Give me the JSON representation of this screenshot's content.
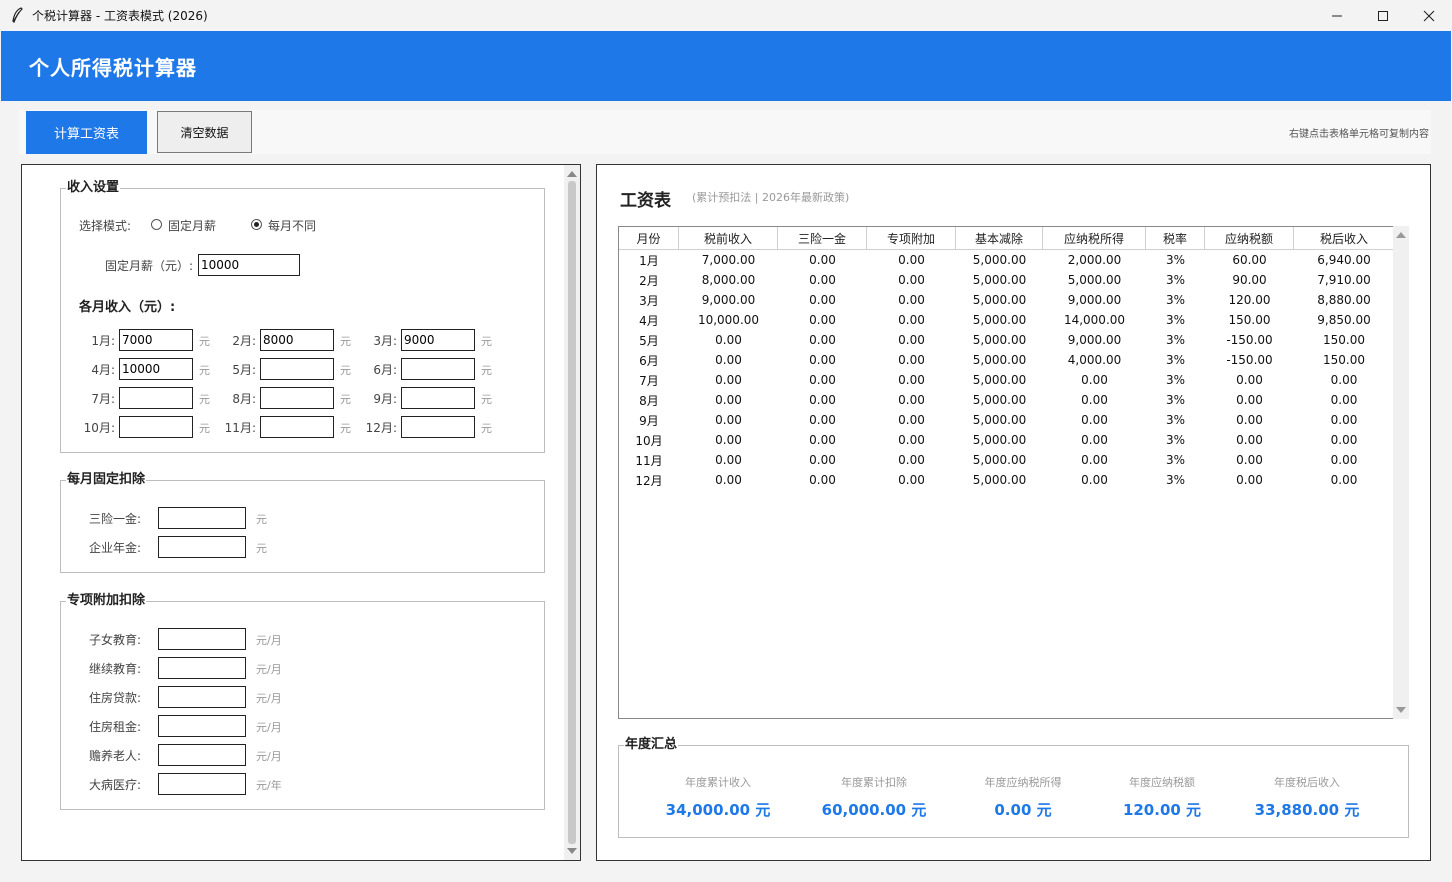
{
  "window": {
    "title": "个税计算器 - 工资表模式 (2026)",
    "icons": [
      "feather-icon",
      "minimize-icon",
      "maximize-icon",
      "close-icon"
    ]
  },
  "header": {
    "title": "个人所得税计算器"
  },
  "toolbar": {
    "calc_label": "计算工资表",
    "clear_label": "清空数据",
    "hint": "右键点击表格单元格可复制内容"
  },
  "income": {
    "legend": "收入设置",
    "mode_label": "选择模式:",
    "mode_fixed": "固定月薪",
    "mode_varied": "每月不同",
    "selected_mode": "每月不同",
    "fixed_label": "固定月薪（元）:",
    "fixed_value": "10000",
    "monthly_title": "各月收入（元）:",
    "unit": "元",
    "months": [
      {
        "label": "1月:",
        "value": "7000"
      },
      {
        "label": "2月:",
        "value": "8000"
      },
      {
        "label": "3月:",
        "value": "9000"
      },
      {
        "label": "4月:",
        "value": "10000"
      },
      {
        "label": "5月:",
        "value": ""
      },
      {
        "label": "6月:",
        "value": ""
      },
      {
        "label": "7月:",
        "value": ""
      },
      {
        "label": "8月:",
        "value": ""
      },
      {
        "label": "9月:",
        "value": ""
      },
      {
        "label": "10月:",
        "value": ""
      },
      {
        "label": "11月:",
        "value": ""
      },
      {
        "label": "12月:",
        "value": ""
      }
    ]
  },
  "fixed_deductions": {
    "legend": "每月固定扣除",
    "items": [
      {
        "label": "三险一金:",
        "value": "",
        "unit": "元"
      },
      {
        "label": "企业年金:",
        "value": "",
        "unit": "元"
      }
    ]
  },
  "special_deductions": {
    "legend": "专项附加扣除",
    "items": [
      {
        "label": "子女教育:",
        "value": "",
        "unit": "元/月"
      },
      {
        "label": "继续教育:",
        "value": "",
        "unit": "元/月"
      },
      {
        "label": "住房贷款:",
        "value": "",
        "unit": "元/月"
      },
      {
        "label": "住房租金:",
        "value": "",
        "unit": "元/月"
      },
      {
        "label": "赡养老人:",
        "value": "",
        "unit": "元/月"
      },
      {
        "label": "大病医疗:",
        "value": "",
        "unit": "元/年"
      }
    ]
  },
  "salary_table": {
    "title": "工资表",
    "subtitle": "(累计预扣法 | 2026年最新政策)",
    "columns": [
      "月份",
      "税前收入",
      "三险一金",
      "专项附加",
      "基本减除",
      "应纳税所得",
      "税率",
      "应纳税额",
      "税后收入"
    ],
    "rows": [
      [
        "1月",
        "7,000.00",
        "0.00",
        "0.00",
        "5,000.00",
        "2,000.00",
        "3%",
        "60.00",
        "6,940.00"
      ],
      [
        "2月",
        "8,000.00",
        "0.00",
        "0.00",
        "5,000.00",
        "5,000.00",
        "3%",
        "90.00",
        "7,910.00"
      ],
      [
        "3月",
        "9,000.00",
        "0.00",
        "0.00",
        "5,000.00",
        "9,000.00",
        "3%",
        "120.00",
        "8,880.00"
      ],
      [
        "4月",
        "10,000.00",
        "0.00",
        "0.00",
        "5,000.00",
        "14,000.00",
        "3%",
        "150.00",
        "9,850.00"
      ],
      [
        "5月",
        "0.00",
        "0.00",
        "0.00",
        "5,000.00",
        "9,000.00",
        "3%",
        "-150.00",
        "150.00"
      ],
      [
        "6月",
        "0.00",
        "0.00",
        "0.00",
        "5,000.00",
        "4,000.00",
        "3%",
        "-150.00",
        "150.00"
      ],
      [
        "7月",
        "0.00",
        "0.00",
        "0.00",
        "5,000.00",
        "0.00",
        "3%",
        "0.00",
        "0.00"
      ],
      [
        "8月",
        "0.00",
        "0.00",
        "0.00",
        "5,000.00",
        "0.00",
        "3%",
        "0.00",
        "0.00"
      ],
      [
        "9月",
        "0.00",
        "0.00",
        "0.00",
        "5,000.00",
        "0.00",
        "3%",
        "0.00",
        "0.00"
      ],
      [
        "10月",
        "0.00",
        "0.00",
        "0.00",
        "5,000.00",
        "0.00",
        "3%",
        "0.00",
        "0.00"
      ],
      [
        "11月",
        "0.00",
        "0.00",
        "0.00",
        "5,000.00",
        "0.00",
        "3%",
        "0.00",
        "0.00"
      ],
      [
        "12月",
        "0.00",
        "0.00",
        "0.00",
        "5,000.00",
        "0.00",
        "3%",
        "0.00",
        "0.00"
      ]
    ]
  },
  "annual_summary": {
    "legend": "年度汇总",
    "items": [
      {
        "label": "年度累计收入",
        "value": "34,000.00 元"
      },
      {
        "label": "年度累计扣除",
        "value": "60,000.00 元"
      },
      {
        "label": "年度应纳税所得",
        "value": "0.00 元"
      },
      {
        "label": "年度应纳税额",
        "value": "120.00 元"
      },
      {
        "label": "年度税后收入",
        "value": "33,880.00 元"
      }
    ]
  },
  "colors": {
    "accent": "#1e78e8",
    "header_bg": "#1e78e8",
    "muted_text": "#999999"
  }
}
